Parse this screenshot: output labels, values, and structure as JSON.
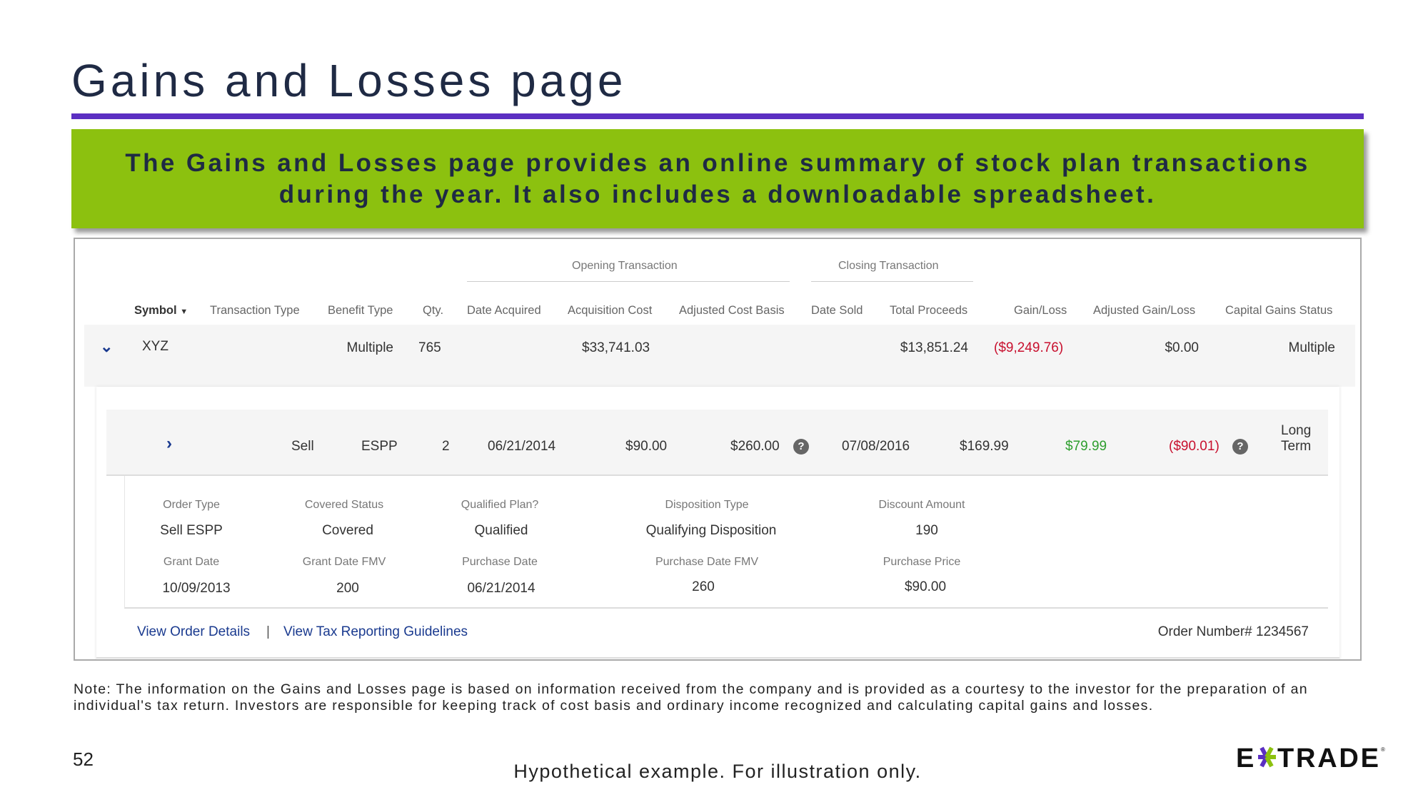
{
  "slide": {
    "title": "Gains and Losses page",
    "banner": "The Gains and Losses page provides an online summary of stock plan transactions during the year. It also includes a downloadable spreadsheet.",
    "note": "Note: The information on the Gains and Losses page is based on information received from the company and is provided as a courtesy to the investor for the preparation of an individual's tax return. Investors are responsible for keeping track of cost basis and ordinary income recognized and calculating capital gains and losses.",
    "page_number": "52",
    "disclaimer": "Hypothetical example. For illustration only.",
    "logo": "E*TRADE",
    "colors": {
      "accent_purple": "#5b2fc2",
      "banner_green": "#8cc10f",
      "loss_red": "#c8102e",
      "gain_green": "#2e9e2e",
      "link_blue": "#1a3a8f"
    }
  },
  "table": {
    "groups": {
      "opening": "Opening Transaction",
      "closing": "Closing Transaction"
    },
    "headers": [
      "Symbol",
      "Transaction Type",
      "Benefit Type",
      "Qty.",
      "Date Acquired",
      "Acquisition Cost",
      "Adjusted Cost Basis",
      "Date Sold",
      "Total Proceeds",
      "Gain/Loss",
      "Adjusted Gain/Loss",
      "Capital Gains Status"
    ],
    "summary": {
      "symbol": "XYZ",
      "benefit_type": "Multiple",
      "qty": "765",
      "acquisition_cost": "$33,741.03",
      "total_proceeds": "$13,851.24",
      "gain_loss": "($9,249.76)",
      "adjusted_gain_loss": "$0.00",
      "capital_gains_status": "Multiple"
    },
    "lot": {
      "transaction_type": "Sell",
      "benefit_type": "ESPP",
      "qty": "2",
      "date_acquired": "06/21/2014",
      "acquisition_cost": "$90.00",
      "adjusted_cost_basis": "$260.00",
      "date_sold": "07/08/2016",
      "total_proceeds": "$169.99",
      "gain_loss": "$79.99",
      "adjusted_gain_loss": "($90.01)",
      "capital_gains_status_1": "Long",
      "capital_gains_status_2": "Term"
    },
    "details": [
      {
        "label": "Order Type",
        "value": "Sell ESPP"
      },
      {
        "label": "Covered Status",
        "value": "Covered"
      },
      {
        "label": "Qualified Plan?",
        "value": "Qualified"
      },
      {
        "label": "Disposition Type",
        "value": "Qualifying Disposition"
      },
      {
        "label": "Discount Amount",
        "value": "190"
      },
      {
        "label": "Grant Date",
        "value": "10/09/2013"
      },
      {
        "label": "Grant Date FMV",
        "value": "200"
      },
      {
        "label": "Purchase Date",
        "value": "06/21/2014"
      },
      {
        "label": "Purchase Date FMV",
        "value": "260"
      },
      {
        "label": "Purchase Price",
        "value": "$90.00"
      }
    ],
    "links": {
      "view_order": "View Order Details",
      "separator": "|",
      "view_tax": "View Tax Reporting Guidelines"
    },
    "order_number_label": "Order Number#",
    "order_number": "1234567"
  }
}
